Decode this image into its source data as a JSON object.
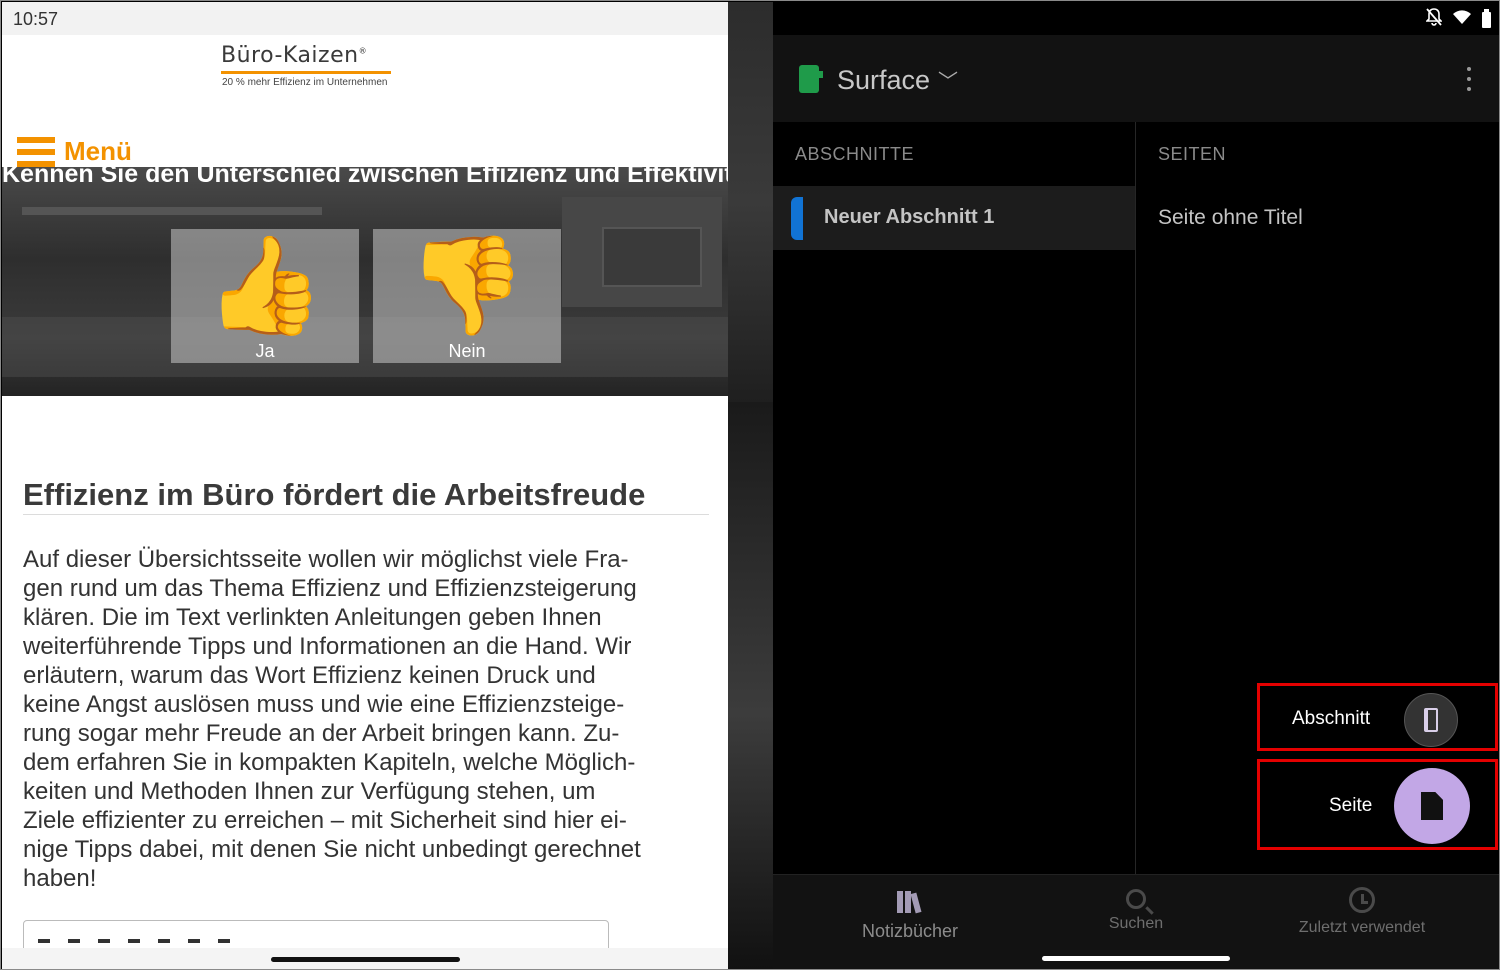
{
  "left": {
    "status": {
      "time": "10:57"
    },
    "logo": {
      "title": "Büro-Kaizen",
      "registered": "®",
      "tagline": "20 % mehr Effizienz im Unternehmen"
    },
    "menu": {
      "label": "Menü"
    },
    "hero": {
      "question": "Kennen Sie den Unterschied zwischen Effizienz und Effektivität?",
      "yes": {
        "emoji": "👍",
        "label": "Ja"
      },
      "no": {
        "emoji": "👎",
        "label": "Nein"
      }
    },
    "article": {
      "title": "Effizienz im Büro fördert die Arbeitsfreude",
      "lines": [
        "Auf dieser Übersichtsseite wollen wir möglichst viele Fra-",
        "gen rund um das Thema Effizienz und Effizienzsteigerung",
        "klären. Die im Text verlinkten Anleitungen geben Ihnen",
        "weiterführende Tipps und Informationen an die Hand. Wir",
        "erläutern, warum das Wort Effizienz keinen Druck und",
        "keine Angst auslösen muss und wie eine Effizienzsteige-",
        "rung sogar mehr Freude an der Arbeit bringen kann. Zu-",
        "dem erfahren Sie in kompakten Kapiteln, welche Möglich-",
        "keiten und Methoden Ihnen zur Verfügung stehen, um",
        "Ziele effizienter zu erreichen – mit Sicherheit sind hier ei-",
        "nige Tipps dabei, mit denen Sie nicht unbedingt gerechnet",
        "haben!"
      ]
    }
  },
  "right": {
    "appbar": {
      "notebook_title": "Surface",
      "chevron": "﹀"
    },
    "sections": {
      "header": "ABSCHNITTE",
      "items": [
        {
          "label": "Neuer Abschnitt 1",
          "color": "#1173d4"
        }
      ]
    },
    "pages": {
      "header": "SEITEN",
      "items": [
        {
          "label": "Seite ohne Titel"
        }
      ]
    },
    "fab": {
      "section_label": "Abschnitt",
      "page_label": "Seite",
      "page_color": "#c2a7e6"
    },
    "bottom_nav": [
      {
        "label": "Notizbücher",
        "icon": "books-icon"
      },
      {
        "label": "Suchen",
        "icon": "search-icon"
      },
      {
        "label": "Zuletzt verwendet",
        "icon": "clock-icon"
      }
    ],
    "status_icons": [
      "bell-off-icon",
      "wifi-icon",
      "battery-icon"
    ]
  },
  "colors": {
    "accent_orange": "#f39200",
    "highlight_red": "#e40000",
    "section_blue": "#1173d4",
    "notebook_green": "#1f9b4a"
  }
}
